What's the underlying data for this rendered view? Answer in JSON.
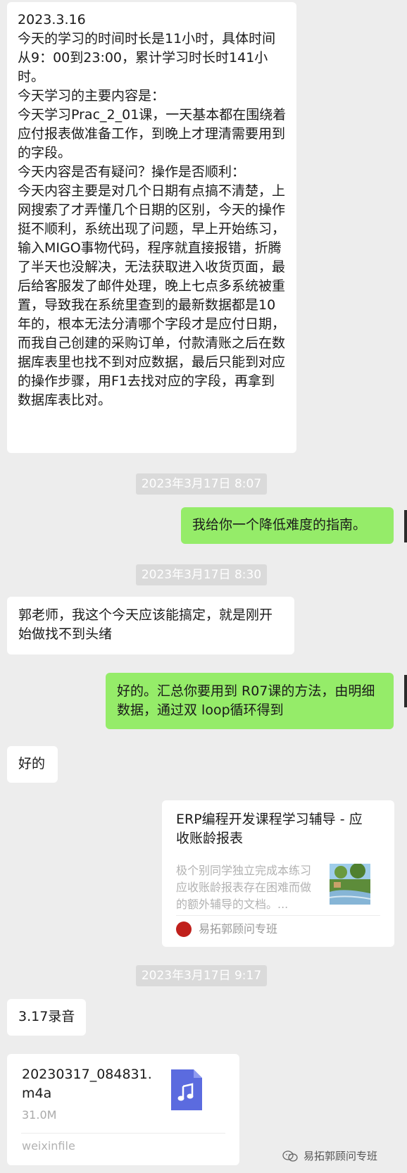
{
  "messages": {
    "m1": {
      "text": "2023.3.16\n今天的学习的时间时长是11小时，具体时间从9：00到23:00，累计学习时长时141小时。\n今天学习的主要内容是：\n今天学习Prac_2_01课，一天基本都在围绕着应付报表做准备工作，到晚上才理清需要用到的字段。\n今天内容是否有疑问？操作是否顺利：\n今天内容主要是对几个日期有点搞不清楚，上网搜索了才弄懂几个日期的区别，今天的操作挺不顺利，系统出现了问题，早上开始练习，输入MIGO事物代码，程序就直接报错，折腾了半天也没解决，无法获取进入收货页面，最后给客服发了邮件处理，晚上七点多系统被重置，导致我在系统里查到的最新数据都是10年的，根本无法分清哪个字段才是应付日期，而我自己创建的采购订单，付款清账之后在数据库表里也找不到对应数据，最后只能到对应的操作步骤，用F1去找对应的字段，再拿到数据库表比对。"
    },
    "t1": "2023年3月17日 8:07",
    "m2": {
      "text": "我给你一个降低难度的指南。"
    },
    "t2": "2023年3月17日 8:30",
    "m3": {
      "text": "郭老师，我这个今天应该能搞定，就是刚开始做找不到头绪"
    },
    "m4": {
      "text": "好的。汇总你要用到 R07课的方法，由明细数据，通过双 loop循环得到"
    },
    "m5": {
      "text": "好的"
    },
    "link_card": {
      "title": "ERP编程开发课程学习辅导 - 应收账龄报表",
      "description": "极个别同学独立完成本练习应收账龄报表存在困难而做的额外辅导的文档。...",
      "source": "易拓郭顾问专班",
      "thumbnail_icon": "landscape-painting"
    },
    "t3": "2023年3月17日 9:17",
    "m6": {
      "text": "3.17录音"
    },
    "file_card": {
      "name": "20230317_084831.m4a",
      "size": "31.0M",
      "source": "weixinfile",
      "icon": "music-note-file-icon"
    }
  },
  "watermark": {
    "text": "易拓郭顾问专班",
    "icon": "wechat-official-account-icon"
  },
  "colors": {
    "background": "#ededed",
    "bubble_self": "#95ec69",
    "bubble_other": "#ffffff",
    "file_icon": "#5b6bdf"
  }
}
